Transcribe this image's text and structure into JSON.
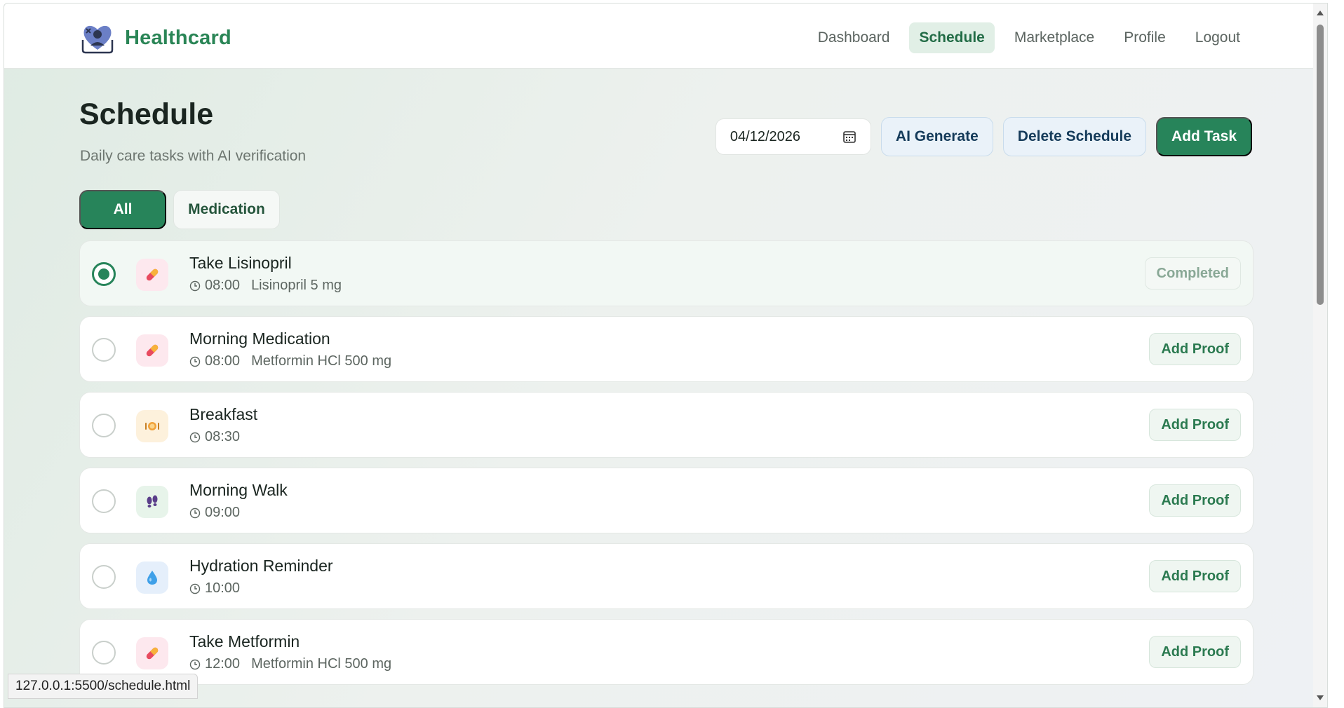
{
  "app": {
    "name": "Healthcard",
    "brand_color": "#2a8556"
  },
  "nav": [
    {
      "label": "Dashboard",
      "active": false
    },
    {
      "label": "Schedule",
      "active": true
    },
    {
      "label": "Marketplace",
      "active": false
    },
    {
      "label": "Profile",
      "active": false
    },
    {
      "label": "Logout",
      "active": false
    }
  ],
  "header": {
    "title": "Schedule",
    "subtitle": "Daily care tasks with AI verification"
  },
  "controls": {
    "date_value": "04/12/2026",
    "ai_generate": "AI Generate",
    "delete_schedule": "Delete Schedule",
    "add_task": "Add Task"
  },
  "filters": [
    {
      "label": "All",
      "active": true
    },
    {
      "label": "Medication",
      "active": false
    }
  ],
  "tasks": [
    {
      "title": "Take Lisinopril",
      "time": "08:00",
      "detail": "Lisinopril 5 mg",
      "icon": "pill-icon",
      "done": true,
      "action": "Completed"
    },
    {
      "title": "Morning Medication",
      "time": "08:00",
      "detail": "Metformin HCl 500 mg",
      "icon": "pill-icon",
      "done": false,
      "action": "Add Proof"
    },
    {
      "title": "Breakfast",
      "time": "08:30",
      "detail": "",
      "icon": "meal-icon",
      "done": false,
      "action": "Add Proof"
    },
    {
      "title": "Morning Walk",
      "time": "09:00",
      "detail": "",
      "icon": "footprints-icon",
      "done": false,
      "action": "Add Proof"
    },
    {
      "title": "Hydration Reminder",
      "time": "10:00",
      "detail": "",
      "icon": "water-drop-icon",
      "done": false,
      "action": "Add Proof"
    },
    {
      "title": "Take Metformin",
      "time": "12:00",
      "detail": "Metformin HCl 500 mg",
      "icon": "pill-icon",
      "done": false,
      "action": "Add Proof"
    }
  ],
  "status_bar": {
    "url": "127.0.0.1:5500/schedule.html"
  }
}
